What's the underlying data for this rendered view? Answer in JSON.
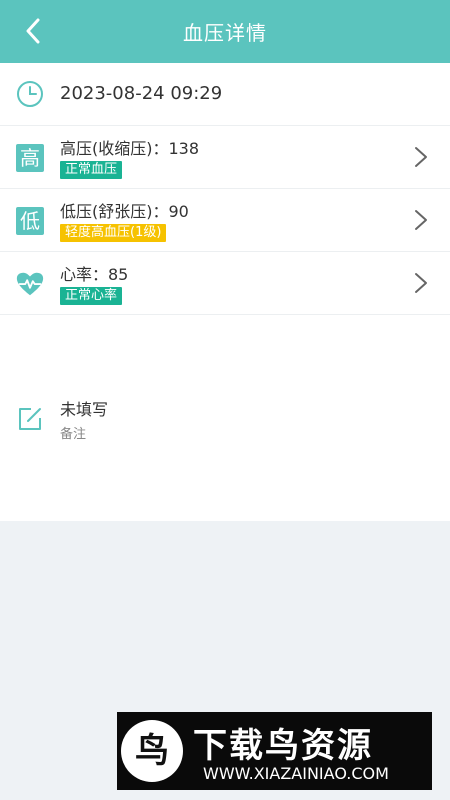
{
  "header": {
    "title": "血压详情",
    "back_icon": "chevron-left-icon",
    "bg_color": "#5bc4be"
  },
  "record": {
    "time": "2023-08-24 09:29",
    "systolic": {
      "icon_glyph": "高",
      "label": "高压(收缩压)：138",
      "tag": "正常血压",
      "tag_color": "#1ab394"
    },
    "diastolic": {
      "icon_glyph": "低",
      "label": "低压(舒张压)：90",
      "tag": "轻度高血压(1级)",
      "tag_color": "#f6c200"
    },
    "heart_rate": {
      "icon": "heartbeat-icon",
      "label": "心率：85",
      "tag": "正常心率",
      "tag_color": "#1ab394"
    }
  },
  "note": {
    "icon": "edit-icon",
    "title": "未填写",
    "subtitle": "备注"
  },
  "watermark": {
    "title": "下载鸟资源",
    "url": "WWW.XIAZAINIAO.COM",
    "logo_glyph": "鸟"
  }
}
